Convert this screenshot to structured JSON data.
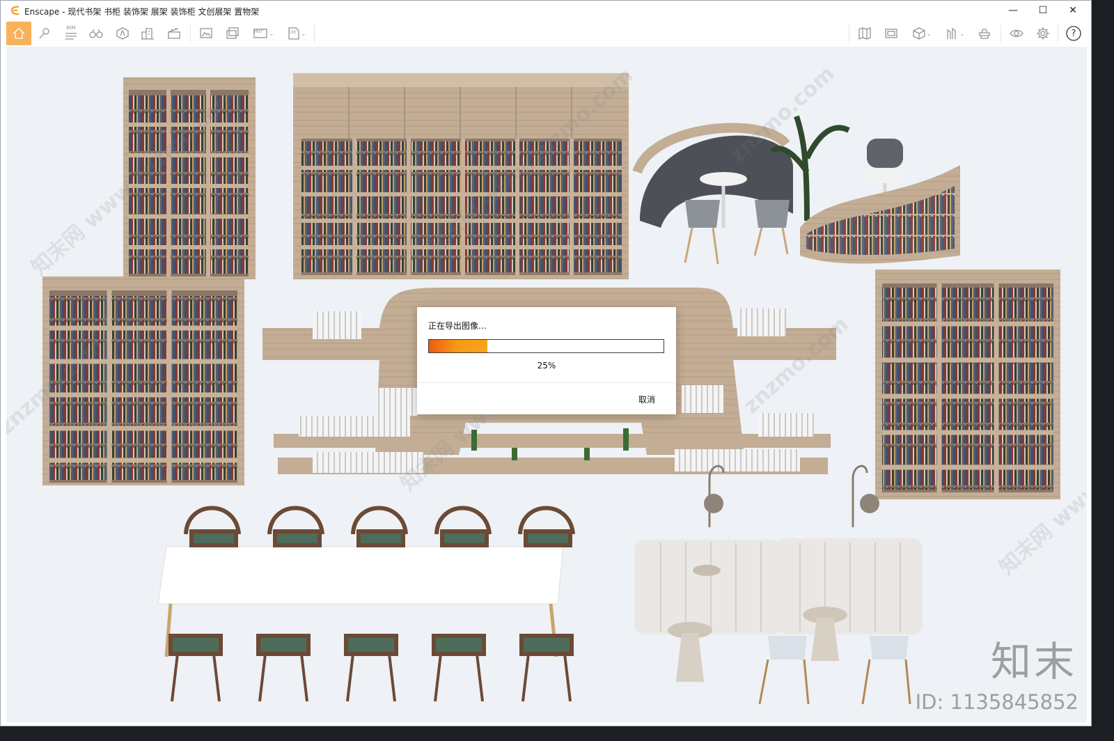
{
  "window": {
    "title": "Enscape - 现代书架 书柜 装饰架 展架 装饰柜 文创展架 置物架",
    "accent": "#f7a033"
  },
  "window_controls": {
    "minimize": "—",
    "maximize": "☐",
    "close": "✕"
  },
  "toolbar_icons": [
    "home-icon",
    "pin-icon",
    "bim-icon",
    "binoculars-icon",
    "assets-icon",
    "buildings-icon",
    "clapper-icon",
    "screenshot-icon",
    "batch-render-icon",
    "panorama-icon",
    "export-icon",
    "map-icon",
    "gallery-icon",
    "cube-icon",
    "sun-icon",
    "render-icon",
    "visibility-icon",
    "settings-icon",
    "help-icon"
  ],
  "toolbar_labels": {
    "bim": "BIM",
    "panorama": "360°",
    "export": "EXE",
    "help": "?"
  },
  "watermark": {
    "brand": "知末",
    "id": "ID: 1135845852",
    "pattern": [
      "知末网 www.znzmo.com",
      "znzmo.com"
    ]
  },
  "dialog": {
    "title": "正在导出图像…",
    "progress": 0.25,
    "percent_label": "25%",
    "cancel_label": "取消"
  }
}
